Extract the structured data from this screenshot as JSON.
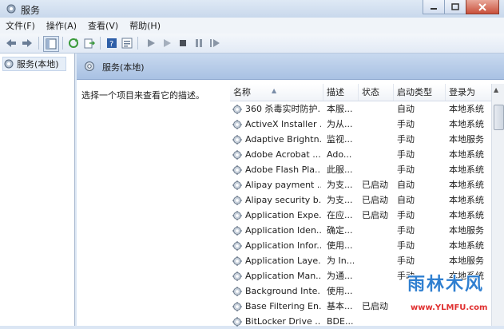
{
  "window": {
    "title": "服务"
  },
  "menu": [
    "文件(F)",
    "操作(A)",
    "查看(V)",
    "帮助(H)"
  ],
  "tree": {
    "item": "服务(本地)"
  },
  "pane": {
    "header": "服务(本地)",
    "description_hint": "选择一个项目来查看它的描述。"
  },
  "table": {
    "columns": [
      "名称",
      "描述",
      "状态",
      "启动类型",
      "登录为"
    ],
    "rows": [
      {
        "name": "360 杀毒实时防护...",
        "desc": "本服...",
        "status": "",
        "startup": "自动",
        "logon": "本地系统"
      },
      {
        "name": "ActiveX Installer ...",
        "desc": "为从...",
        "status": "",
        "startup": "手动",
        "logon": "本地系统"
      },
      {
        "name": "Adaptive Brightn...",
        "desc": "监视...",
        "status": "",
        "startup": "手动",
        "logon": "本地服务"
      },
      {
        "name": "Adobe Acrobat ...",
        "desc": "Ado...",
        "status": "",
        "startup": "手动",
        "logon": "本地系统"
      },
      {
        "name": "Adobe Flash Pla...",
        "desc": "此服...",
        "status": "",
        "startup": "手动",
        "logon": "本地系统"
      },
      {
        "name": "Alipay payment ...",
        "desc": "为支...",
        "status": "已启动",
        "startup": "自动",
        "logon": "本地系统"
      },
      {
        "name": "Alipay security b...",
        "desc": "为支...",
        "status": "已启动",
        "startup": "自动",
        "logon": "本地系统"
      },
      {
        "name": "Application Expe...",
        "desc": "在应...",
        "status": "已启动",
        "startup": "手动",
        "logon": "本地系统"
      },
      {
        "name": "Application Iden...",
        "desc": "确定...",
        "status": "",
        "startup": "手动",
        "logon": "本地服务"
      },
      {
        "name": "Application Infor...",
        "desc": "使用...",
        "status": "",
        "startup": "手动",
        "logon": "本地系统"
      },
      {
        "name": "Application Laye...",
        "desc": "为 In...",
        "status": "",
        "startup": "手动",
        "logon": "本地服务"
      },
      {
        "name": "Application Man...",
        "desc": "为通...",
        "status": "",
        "startup": "手动",
        "logon": "本地系统"
      },
      {
        "name": "Background Inte...",
        "desc": "使用...",
        "status": "",
        "startup": "",
        "logon": ""
      },
      {
        "name": "Base Filtering En...",
        "desc": "基本...",
        "status": "已启动",
        "startup": "",
        "logon": ""
      },
      {
        "name": "BitLocker Drive ...",
        "desc": "BDE...",
        "status": "",
        "startup": "",
        "logon": ""
      }
    ]
  },
  "watermark": {
    "brand": "雨林木风",
    "url": "www.YLMFU.com"
  },
  "colors": {
    "header_blue": "#a9c1e3",
    "tree_bg": "#ffffff",
    "watermark_blue": "#2f7fd0",
    "watermark_red": "#e03030"
  }
}
